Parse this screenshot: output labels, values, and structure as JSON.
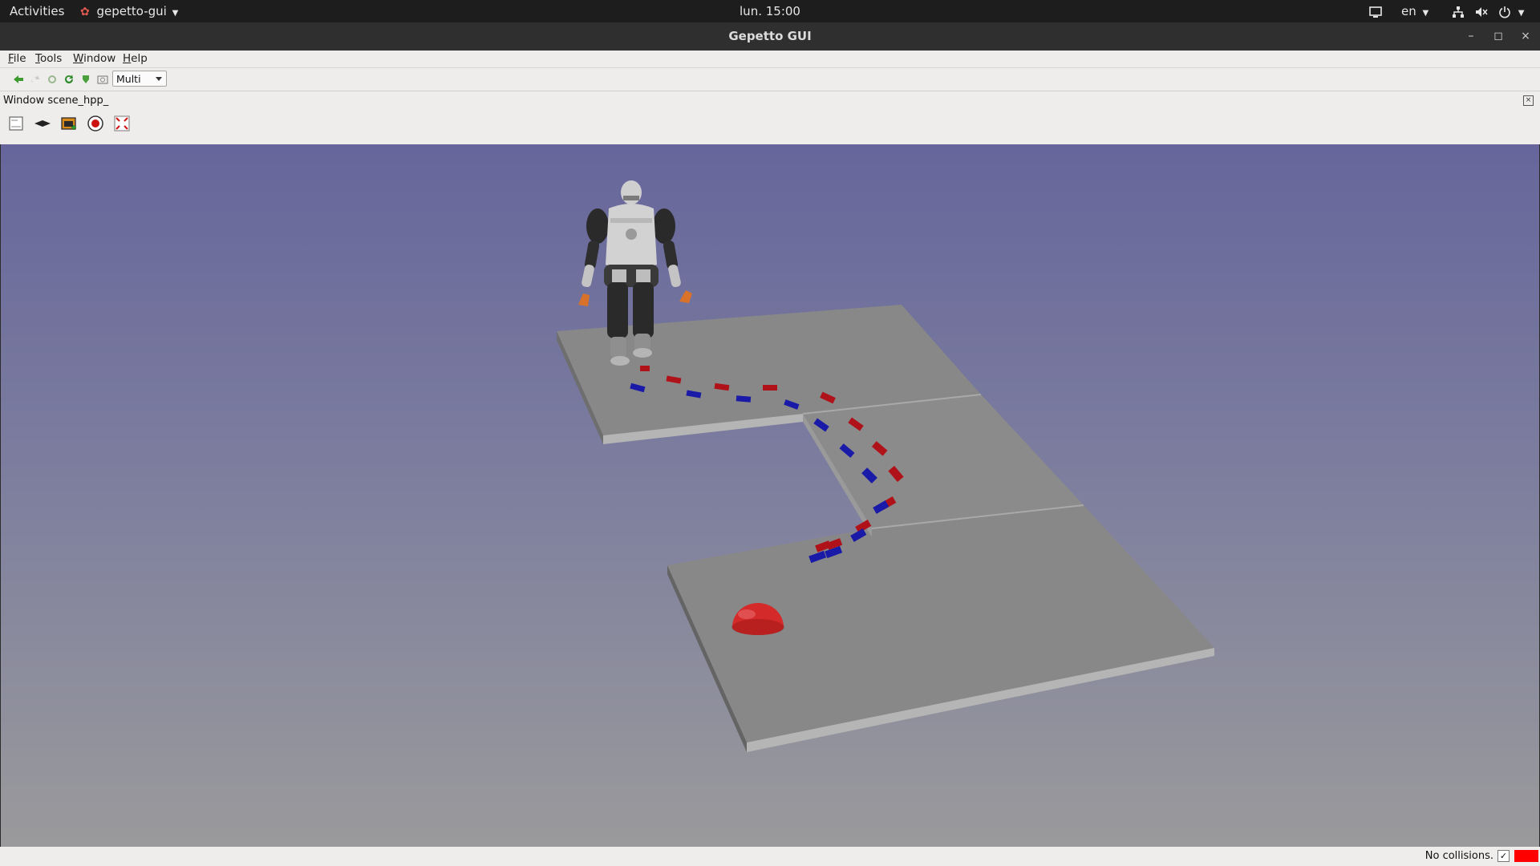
{
  "topbar": {
    "activities": "Activities",
    "app_name": "gepetto-gui",
    "clock": "lun. 15:00",
    "keyboard_lang": "en"
  },
  "window": {
    "title": "Gepetto GUI"
  },
  "menubar": {
    "items": [
      "File",
      "Tools",
      "Window",
      "Help"
    ]
  },
  "toolbar": {
    "mode_value": "Multi"
  },
  "dock": {
    "title": "Window scene_hpp_"
  },
  "status": {
    "text": "No collisions.",
    "check_mark": "✓",
    "collision_color": "#ff0000"
  },
  "colors": {
    "viewport_top": "#66669c",
    "viewport_bottom": "#9a9a9c",
    "footstep_left": "#1a1aa8",
    "footstep_right": "#b0121a",
    "goal_sphere": "#d42a2a",
    "floor": "#8a8a8a"
  }
}
